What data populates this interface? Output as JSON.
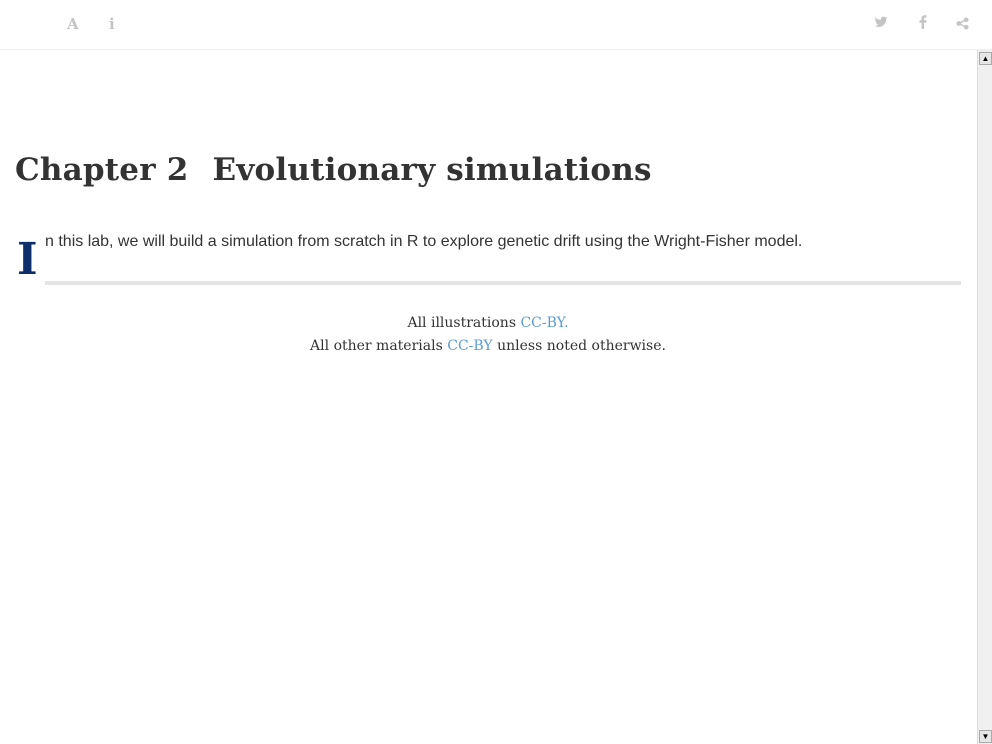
{
  "toolbar": {
    "font_icon": "A",
    "info_icon": "i"
  },
  "share": {
    "twitter": "twitter-icon",
    "facebook": "facebook-icon",
    "share": "share-icon"
  },
  "chapter": {
    "number": "Chapter 2",
    "title": "Evolutionary simulations"
  },
  "intro": {
    "dropcap": "I",
    "text": "n this lab, we will build a simulation from scratch in R to explore genetic drift using the Wright-Fisher model."
  },
  "footer": {
    "line1_prefix": "All illustrations ",
    "line1_link": "CC-BY.",
    "line2_prefix": "All other materials ",
    "line2_link": "CC-BY",
    "line2_suffix": " unless noted otherwise."
  },
  "colors": {
    "link": "#5b9bd5",
    "dropcap": "#0c2f6b"
  }
}
